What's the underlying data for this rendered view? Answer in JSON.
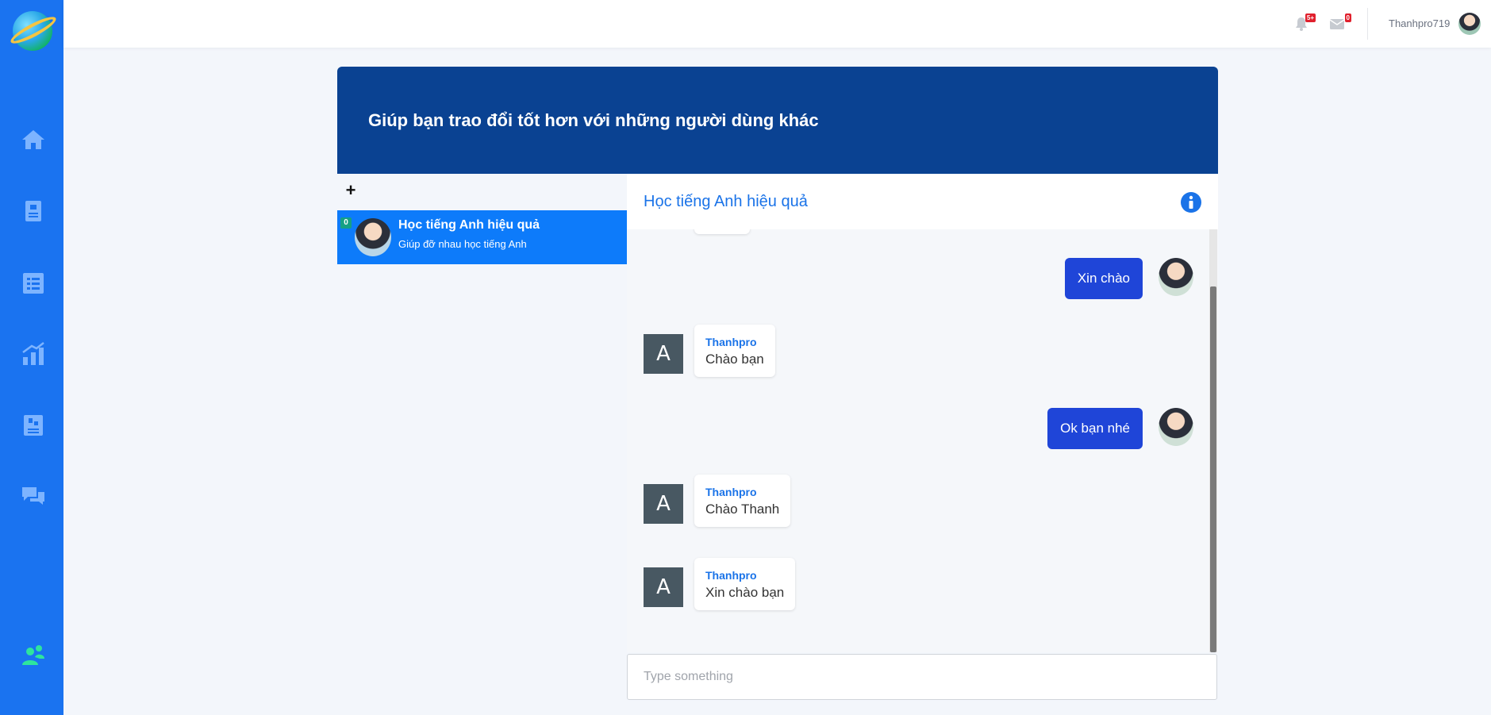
{
  "topbar": {
    "notifications_badge": "5+",
    "messages_badge": "0",
    "username": "Thanhpro719"
  },
  "sidebar": {
    "items": [
      {
        "icon": "home-icon"
      },
      {
        "icon": "book-icon"
      },
      {
        "icon": "clipboard-checklist-icon"
      },
      {
        "icon": "bar-chart-icon"
      },
      {
        "icon": "dictionary-icon"
      },
      {
        "icon": "chat-bubbles-icon"
      },
      {
        "icon": "users-icon"
      }
    ],
    "accent": "#1a73f0"
  },
  "banner": {
    "text": "Giúp bạn trao đổi tốt hơn với những người dùng khác"
  },
  "conversations": {
    "add_label": "+",
    "items": [
      {
        "count": "0",
        "title": "Học tiếng Anh hiệu quả",
        "subtitle": "Giúp đỡ nhau học tiếng Anh"
      }
    ]
  },
  "chat": {
    "title": "Học tiếng Anh hiệu quả",
    "messages": [
      {
        "direction": "out",
        "text": "Xin chào"
      },
      {
        "direction": "in",
        "avatar_letter": "A",
        "sender": "Thanhpro",
        "text": "Chào bạn"
      },
      {
        "direction": "out",
        "text": "Ok bạn nhé"
      },
      {
        "direction": "in",
        "avatar_letter": "A",
        "sender": "Thanhpro",
        "text": "Chào Thanh"
      },
      {
        "direction": "in",
        "avatar_letter": "A",
        "sender": "Thanhpro",
        "text": "Xin chào bạn"
      }
    ],
    "input": {
      "value": "",
      "placeholder": "Type something"
    }
  }
}
